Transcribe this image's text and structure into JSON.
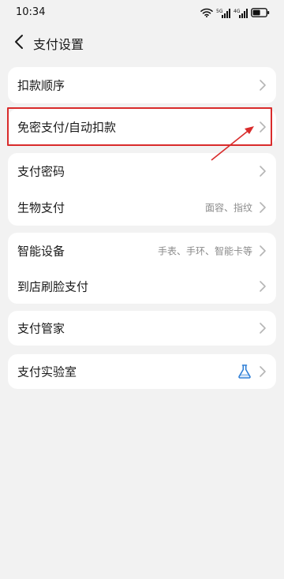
{
  "status_bar": {
    "time": "10:34"
  },
  "header": {
    "title": "支付设置"
  },
  "sections": [
    {
      "items": [
        {
          "label": "扣款顺序",
          "value": ""
        }
      ]
    },
    {
      "items": [
        {
          "label": "免密支付/自动扣款",
          "value": ""
        }
      ]
    },
    {
      "items": [
        {
          "label": "支付密码",
          "value": ""
        },
        {
          "label": "生物支付",
          "value": "面容、指纹"
        }
      ]
    },
    {
      "items": [
        {
          "label": "智能设备",
          "value": "手表、手环、智能卡等"
        },
        {
          "label": "到店刷脸支付",
          "value": ""
        }
      ]
    },
    {
      "items": [
        {
          "label": "支付管家",
          "value": ""
        }
      ]
    },
    {
      "items": [
        {
          "label": "支付实验室",
          "value": "",
          "icon": "flask-icon"
        }
      ]
    }
  ],
  "colors": {
    "background": "#f2f2f2",
    "card": "#ffffff",
    "highlight": "#d92b2b",
    "lab_icon": "#2f7fd6"
  }
}
